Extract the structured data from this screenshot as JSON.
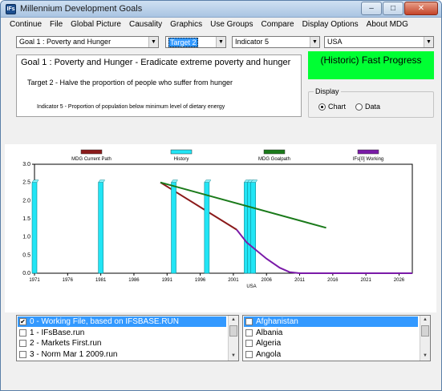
{
  "window": {
    "title": "Millennium Development Goals",
    "icon_text": "IFs",
    "buttons": {
      "minimize": "–",
      "maximize": "□",
      "close": "✕"
    }
  },
  "menu": [
    "Continue",
    "File",
    "Global Picture",
    "Causality",
    "Graphics",
    "Use Groups",
    "Compare",
    "Display Options",
    "About MDG"
  ],
  "selectors": {
    "goal": "Goal 1 : Poverty and Hunger",
    "target": "Target 2",
    "indicator": "Indicator 5",
    "country": "USA"
  },
  "info": {
    "goal_title": "Goal 1 : Poverty and Hunger - Eradicate extreme poverty and hunger",
    "target_text": "Target 2 - Halve the proportion of people who suffer from hunger",
    "indicator_text": "Indicator 5 - Proportion of population below minimum level of dietary energy"
  },
  "status": {
    "label": "(Historic) Fast Progress",
    "color": "#00ff33"
  },
  "display": {
    "legend": "Display",
    "options": [
      {
        "label": "Chart",
        "selected": true
      },
      {
        "label": "Data",
        "selected": false
      }
    ]
  },
  "chart_data": {
    "type": "line",
    "xlabel": "USA",
    "ylabel": "",
    "xlim": [
      1971,
      2028
    ],
    "ylim": [
      0,
      3.0
    ],
    "y_ticks": [
      "0.0",
      "0.5",
      "1.0",
      "1.5",
      "2.0",
      "2.5",
      "3.0"
    ],
    "x_ticks": [
      {
        "label": "1971",
        "value": 1971
      },
      {
        "label": "1976",
        "value": 1976
      },
      {
        "label": "1981",
        "value": 1981
      },
      {
        "label": "1986",
        "value": 1986
      },
      {
        "label": "1991",
        "value": 1991
      },
      {
        "label": "1996",
        "value": 1996
      },
      {
        "label": "2001",
        "value": 2001
      },
      {
        "label": "2006",
        "value": 2006
      },
      {
        "label": "2011",
        "value": 2011
      },
      {
        "label": "2016",
        "value": 2016
      },
      {
        "label": "2021",
        "value": 2021
      },
      {
        "label": "2026",
        "value": 2026
      }
    ],
    "series": [
      {
        "name": "MDG Current Path",
        "color": "#8b1a1a",
        "points": [
          [
            1990,
            2.5
          ],
          [
            2001.5,
            1.2
          ]
        ]
      },
      {
        "name": "History",
        "color": "#22e5f5",
        "style": "bar",
        "points": [
          [
            1971,
            2.5
          ],
          [
            1981,
            2.5
          ],
          [
            1992,
            2.5
          ],
          [
            1997,
            2.5
          ],
          [
            2003,
            2.5
          ],
          [
            2003.5,
            2.5
          ],
          [
            2004,
            2.5
          ]
        ]
      },
      {
        "name": "MDG Goalpath",
        "color": "#1a7a1a",
        "points": [
          [
            1990,
            2.5
          ],
          [
            2015,
            1.25
          ]
        ]
      },
      {
        "name": "IFs[0] Working",
        "color": "#7a1aa8",
        "points": [
          [
            2001.5,
            1.2
          ],
          [
            2003,
            0.85
          ],
          [
            2006,
            0.4
          ],
          [
            2008,
            0.15
          ],
          [
            2009.5,
            0.03
          ],
          [
            2011,
            0.0
          ],
          [
            2028,
            0.0
          ]
        ]
      }
    ]
  },
  "scenarios": [
    {
      "label": "0 - Working File, based on IFSBASE.RUN",
      "checked": true,
      "selected": true
    },
    {
      "label": "1 - IFsBase.run",
      "checked": false,
      "selected": false
    },
    {
      "label": "2 - Markets First.run",
      "checked": false,
      "selected": false
    },
    {
      "label": "3 - Norm Mar 1 2009.run",
      "checked": false,
      "selected": false
    }
  ],
  "countries": [
    {
      "label": "Afghanistan",
      "checked": false,
      "selected": true
    },
    {
      "label": "Albania",
      "checked": false,
      "selected": false
    },
    {
      "label": "Algeria",
      "checked": false,
      "selected": false
    },
    {
      "label": "Angola",
      "checked": false,
      "selected": false
    }
  ]
}
